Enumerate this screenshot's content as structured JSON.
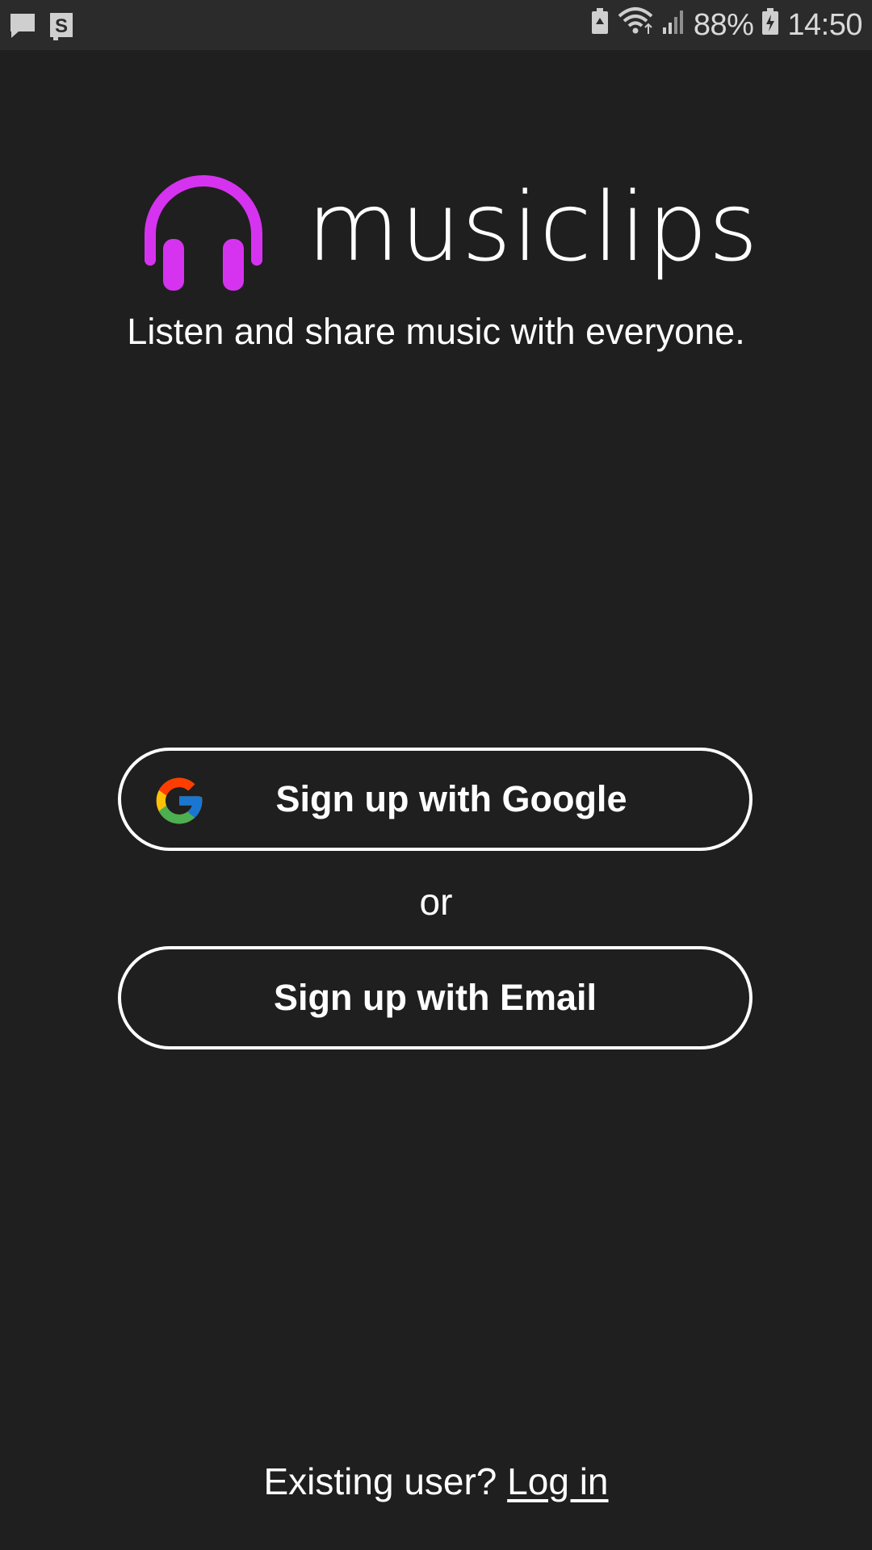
{
  "status_bar": {
    "left_icons": [
      "message-icon",
      "s-app-icon"
    ],
    "right_icons": [
      "battery-saver-icon",
      "wifi-icon",
      "signal-icon",
      "battery-icon"
    ],
    "battery_percent": "88%",
    "time": "14:50"
  },
  "app": {
    "name": "musiclips",
    "tagline": "Listen and share music with everyone.",
    "logo_icon": "headphones-icon",
    "accent_color": "#d633f0"
  },
  "buttons": {
    "google_label": "Sign up with Google",
    "google_icon": "google-icon",
    "separator": "or",
    "email_label": "Sign up with Email"
  },
  "footer": {
    "prompt": "Existing user?",
    "login_label": "Log in"
  },
  "colors": {
    "background": "#1f1f1f",
    "status_bar": "#2b2b2b",
    "text": "#ffffff"
  }
}
